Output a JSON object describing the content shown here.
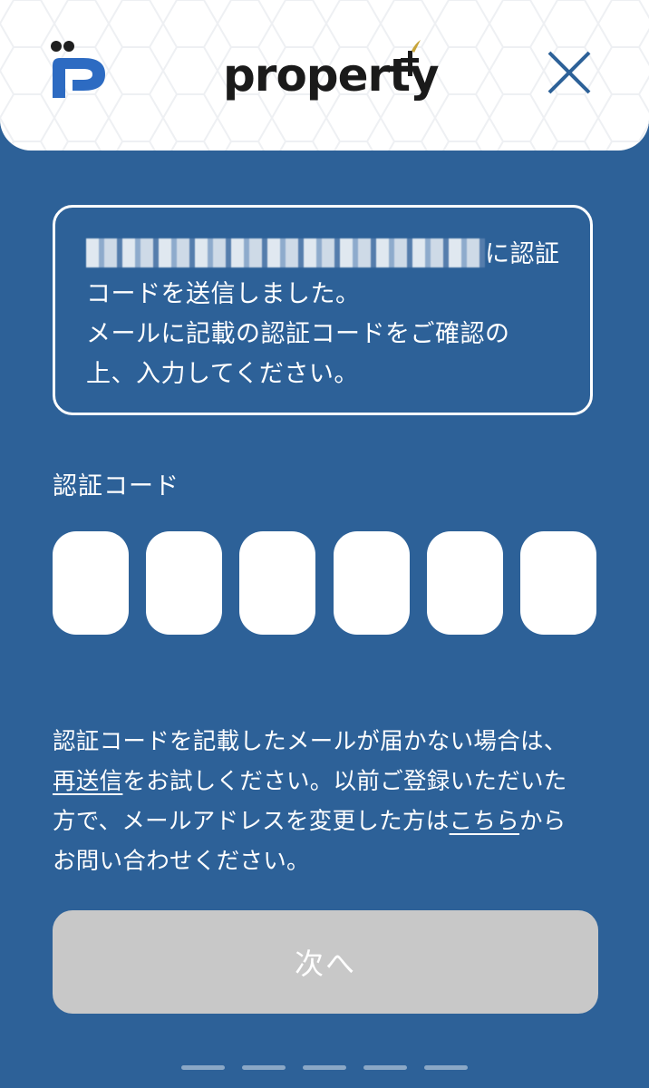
{
  "header": {
    "brand": "property",
    "colors": {
      "logo_blue": "#2d6bc2",
      "plus_gold": "#c7a43a",
      "close_icon": "#2d6198"
    }
  },
  "notice": {
    "masked_email": "",
    "line1_suffix": "に認証",
    "line2": "コードを送信しました。",
    "line3": "メールに記載の認証コードをご確認の",
    "line4": "上、入力してください。"
  },
  "code": {
    "label": "認証コード",
    "values": [
      "",
      "",
      "",
      "",
      "",
      ""
    ]
  },
  "help": {
    "line1": "認証コードを記載したメールが届かない場合は、",
    "resend_link": "再送信",
    "line2_rest": "をお試しください。以前ご登録いただいた",
    "line3_pre": "方で、メールアドレスを変更した方は",
    "here_link": "こちら",
    "line3_post": "から",
    "line4": "お問い合わせください。"
  },
  "next_button": {
    "label": "次へ",
    "enabled": false,
    "bg_color": "#c8c8c8"
  },
  "pager": {
    "count": 5
  },
  "theme": {
    "background": "#2d6198"
  }
}
